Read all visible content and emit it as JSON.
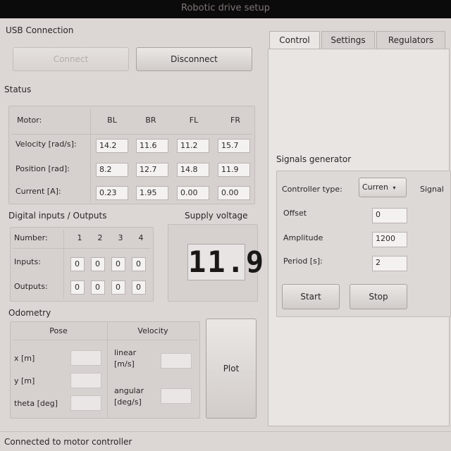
{
  "window": {
    "title": "Robotic drive setup"
  },
  "usb": {
    "title": "USB Connection",
    "connect_label": "Connect",
    "disconnect_label": "Disconnect"
  },
  "status": {
    "title": "Status",
    "motor_label": "Motor:",
    "columns": [
      "BL",
      "BR",
      "FL",
      "FR"
    ],
    "rows": [
      {
        "label": "Velocity [rad/s]:",
        "values": [
          "14.2",
          "11.6",
          "11.2",
          "15.7"
        ]
      },
      {
        "label": "Position [rad]:",
        "values": [
          "8.2",
          "12.7",
          "14.8",
          "11.9"
        ]
      },
      {
        "label": "Current [A]:",
        "values": [
          "0.23",
          "1.95",
          "0.00",
          "0.00"
        ]
      }
    ]
  },
  "digital_io": {
    "title": "Digital inputs / Outputs",
    "number_label": "Number:",
    "numbers": [
      "1",
      "2",
      "3",
      "4"
    ],
    "inputs_label": "Inputs:",
    "inputs": [
      "0",
      "0",
      "0",
      "0"
    ],
    "outputs_label": "Outputs:",
    "outputs": [
      "0",
      "0",
      "0",
      "0"
    ]
  },
  "supply": {
    "title": "Supply voltage",
    "value": "11.9"
  },
  "odometry": {
    "title": "Odometry",
    "pose_header": "Pose",
    "velocity_header": "Velocity",
    "x_label": "x [m]",
    "y_label": "y [m]",
    "theta_label": "theta [deg]",
    "x_value": "",
    "y_value": "",
    "theta_value": "",
    "linear_label_1": "linear",
    "linear_label_2": "[m/s]",
    "angular_label_1": "angular",
    "angular_label_2": "[deg/s]",
    "linear_value": "",
    "angular_value": "",
    "plot_label": "Plot"
  },
  "tabs": [
    "Control",
    "Settings",
    "Regulators"
  ],
  "signal_generator": {
    "title": "Signals generator",
    "controller_type_label": "Controller type:",
    "controller_type_value": "Curren",
    "signal_label": "Signal",
    "offset_label": "Offset",
    "offset_value": "0",
    "amplitude_label": "Amplitude",
    "amplitude_value": "1200",
    "period_label": "Period [s]:",
    "period_value": "2",
    "start_label": "Start",
    "stop_label": "Stop"
  },
  "statusbar": {
    "text": "Connected to motor controller"
  }
}
